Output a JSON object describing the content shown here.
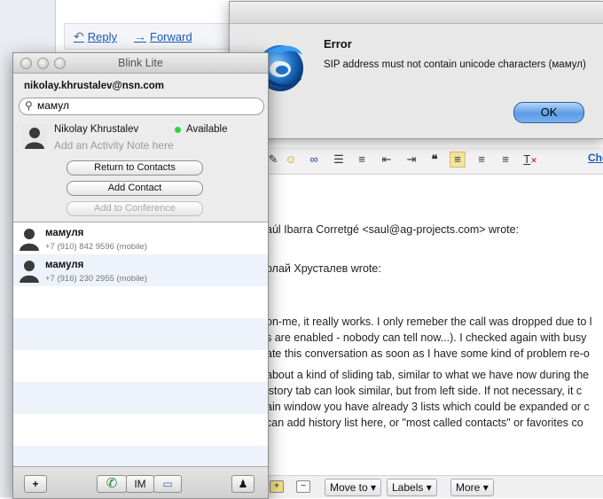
{
  "mail": {
    "reply_label": "Reply",
    "forward_label": "Forward",
    "toolbar_link": "Che",
    "lines": [
      "aúl Ibarra Corretgé <saul@ag-projects.com> wrote:",
      "олай Хрусталев wrote:",
      "on-me, it really works. I only remeber the call was dropped due to l",
      "s are enabled - nobody can tell now...). I checked again with busy",
      "ate this conversation as soon as I have some kind of problem re-o",
      " about a kind of sliding tab, similar to what we have now during the",
      "istory tab can look similar, but from left side. If not necessary, it c",
      "ain window you have already 3 lists which could be expanded or c",
      "can add history list here, or \"most called contacts\" or favorites co"
    ],
    "bottom": {
      "move_to": "Move to",
      "labels": "Labels",
      "more": "More"
    }
  },
  "dialog": {
    "title": "Error",
    "message": "SIP address must not contain unicode characters (мамул)",
    "ok_label": "OK"
  },
  "blink": {
    "window_title": "Blink Lite",
    "account": "nikolay.khrustalev@nsn.com",
    "search_value": "мамул",
    "me": {
      "name": "Nikolay Khrustalev",
      "presence": "Available",
      "activity_placeholder": "Add an Activity Note here"
    },
    "buttons": {
      "return_to_contacts": "Return to Contacts",
      "add_contact": "Add Contact",
      "add_to_conference": "Add to Conference"
    },
    "contacts": [
      {
        "name": "мамуля",
        "number": "+7 (910) 842 9596 (mobile)"
      },
      {
        "name": "мамуля",
        "number": "+7 (916) 230 2955 (mobile)"
      }
    ],
    "bottom": {
      "add": "+",
      "im": "IM"
    }
  }
}
